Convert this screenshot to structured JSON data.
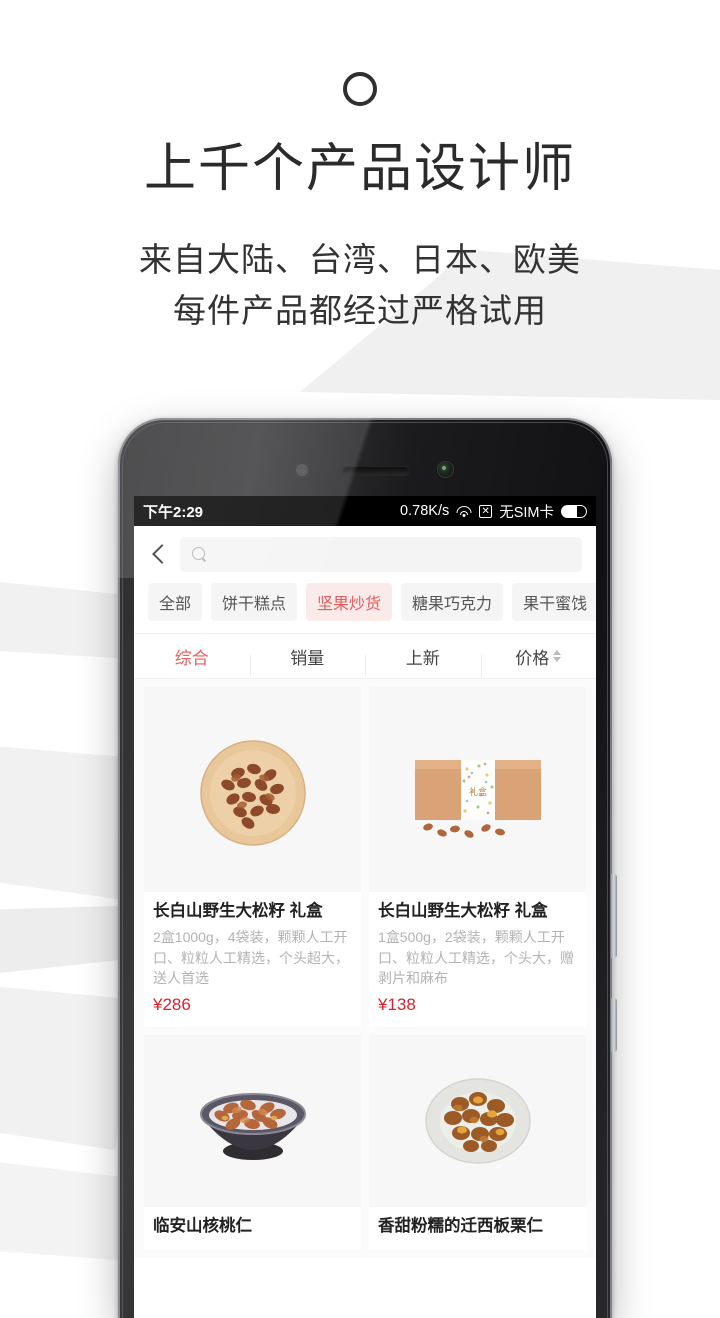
{
  "promo": {
    "logo_icon": "ring-logo-icon",
    "title": "上千个产品设计师",
    "subtitle_line1": "来自大陆、台湾、日本、欧美",
    "subtitle_line2": "每件产品都经过严格试用"
  },
  "phone": {
    "sensor_icon": "proximity-sensor-icon",
    "earpiece_icon": "earpiece-speaker-icon",
    "camera_icon": "front-camera-icon",
    "volume_button": "volume-rocker",
    "power_button": "power-button"
  },
  "statusbar": {
    "time": "下午2:29",
    "network_speed": "0.78K/s",
    "wifi_icon": "wifi-icon",
    "x_icon": "✕",
    "sim_status": "无SIM卡",
    "battery_icon": "battery-icon"
  },
  "navbar": {
    "back_icon": "back-chevron-icon",
    "search_icon": "search-icon",
    "search_value": "",
    "search_placeholder": ""
  },
  "categories": [
    {
      "label": "全部",
      "active": false
    },
    {
      "label": "饼干糕点",
      "active": false
    },
    {
      "label": "坚果炒货",
      "active": true
    },
    {
      "label": "糖果巧克力",
      "active": false
    },
    {
      "label": "果干蜜饯",
      "active": false
    }
  ],
  "sorts": [
    {
      "label": "综合",
      "active": true,
      "has_arrows": false
    },
    {
      "label": "销量",
      "active": false,
      "has_arrows": false
    },
    {
      "label": "上新",
      "active": false,
      "has_arrows": false
    },
    {
      "label": "价格",
      "active": false,
      "has_arrows": true
    }
  ],
  "products": [
    {
      "title": "长白山野生大松籽 礼盒",
      "desc": "2盒1000g，4袋装，颗颗人工开口、粒粒人工精选，个头超大，送人首选",
      "price": "¥286",
      "image": "pine-nuts-on-wooden-plate"
    },
    {
      "title": "长白山野生大松籽 礼盒",
      "desc": "1盒500g，2袋装，颗颗人工开口、粒粒人工精选，个头大，赠剥片和麻布",
      "price": "¥138",
      "image": "kraft-gift-box-with-patterned-band"
    },
    {
      "title": "临安山核桃仁",
      "desc": "",
      "price": "",
      "image": "walnut-kernels-in-dark-ceramic-bowl"
    },
    {
      "title": "香甜粉糯的迁西板栗仁",
      "desc": "",
      "price": "",
      "image": "chestnuts-on-pale-ceramic-plate"
    }
  ],
  "colors": {
    "accent_red": "#e35c5c",
    "price_red": "#d8232a",
    "chip_active_bg": "#fbeaea",
    "background": "#ffffff"
  }
}
